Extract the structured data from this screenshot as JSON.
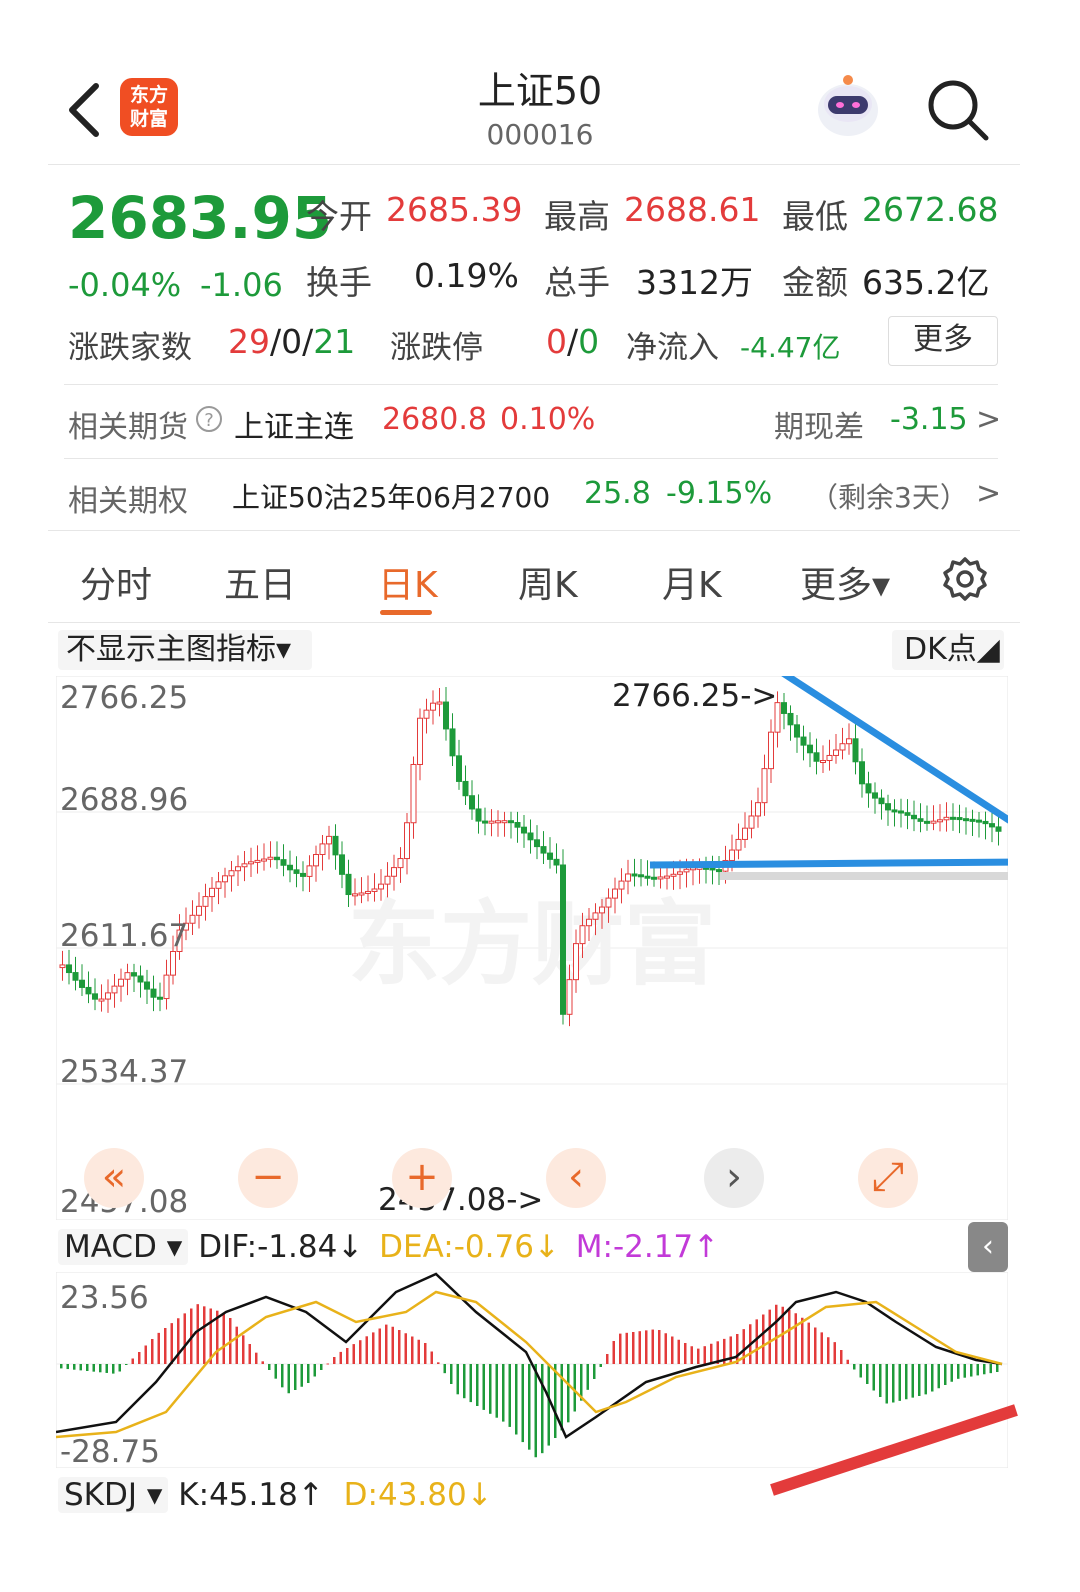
{
  "header": {
    "logo_text_1": "东方",
    "logo_text_2": "财富",
    "title": "上证50",
    "code": "000016",
    "icons": [
      "back-arrow-icon",
      "robot-avatar-icon",
      "search-icon"
    ]
  },
  "quote": {
    "price": "2683.95",
    "change_pct": "-0.04%",
    "change_val": "-1.06",
    "open_label": "今开",
    "open": "2685.39",
    "high_label": "最高",
    "high": "2688.61",
    "low_label": "最低",
    "low": "2672.68",
    "turnover_label": "换手",
    "turnover": "0.19%",
    "volume_label": "总手",
    "volume": "3312万",
    "amount_label": "金额",
    "amount": "635.2亿",
    "breadth_label": "涨跌家数",
    "breadth_up": "29",
    "breadth_sep1": "/",
    "breadth_flat": "0",
    "breadth_sep2": "/",
    "breadth_down": "21",
    "limit_label": "涨跌停",
    "limit_up": "0",
    "limit_sep": "/",
    "limit_down": "0",
    "netflow_label": "净流入",
    "netflow": "-4.47亿",
    "more": "更多"
  },
  "futures": {
    "label": "相关期货",
    "help_icon": "?",
    "name": "上证主连",
    "price": "2680.8",
    "pct": "0.10%",
    "basis_label": "期现差",
    "basis": "-3.15",
    "arrow": ">"
  },
  "options": {
    "label": "相关期权",
    "name": "上证50沽25年06月2700",
    "price": "25.8",
    "pct": "-9.15%",
    "remaining": "（剩余3天）",
    "arrow": ">"
  },
  "tabs": [
    {
      "label": "分时"
    },
    {
      "label": "五日"
    },
    {
      "label": "日K",
      "active": true
    },
    {
      "label": "周K"
    },
    {
      "label": "月K"
    },
    {
      "label": "更多▾"
    }
  ],
  "chart": {
    "indicator_select": "不显示主图指标▾",
    "dk_select": "DK点◢",
    "watermark": "东方财富",
    "y_labels": [
      "2766.25",
      "2688.96",
      "2611.67",
      "2534.37",
      "2457.08"
    ],
    "high_annotation": "2766.25->",
    "low_annotation": "2457.08->",
    "controls": [
      "«",
      "−",
      "+",
      "‹",
      "›",
      "⤢"
    ]
  },
  "macd": {
    "select": "MACD ▾",
    "dif": "DIF:-1.84↓",
    "dea": "DEA:-0.76↓",
    "m": "M:-2.17↑",
    "top_label": "23.56",
    "bottom_label": "-28.75",
    "collapse": "‹"
  },
  "skdj": {
    "select": "SKDJ ▾",
    "k": "K:45.18↑",
    "d": "D:43.80↓"
  },
  "colors": {
    "up": "#e33b3b",
    "down": "#1d9a3a",
    "accent": "#e8692b",
    "trendline": "#2a8ee0",
    "dea": "#e8b21a",
    "m": "#c23ad8"
  }
}
